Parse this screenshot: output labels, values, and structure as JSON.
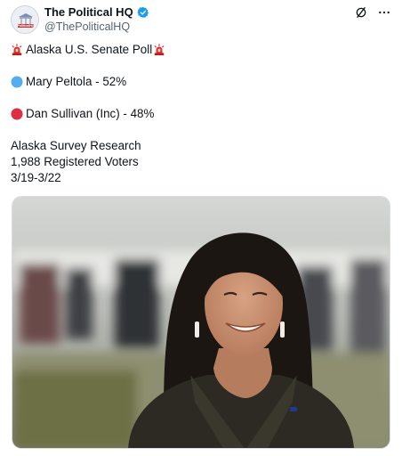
{
  "author": {
    "display_name": "The Political HQ",
    "handle": "@ThePoliticalHQ",
    "verified": true,
    "avatar_icon": "political-hq-logo-icon",
    "avatar_label": "PoliticalHQ"
  },
  "header_icons": [
    "grok-icon",
    "more-icon"
  ],
  "post": {
    "title": "Alaska U.S. Senate Poll",
    "title_icon": "siren-icon",
    "candidates": [
      {
        "name_pct": "Mary Peltola - 52%",
        "color": "#55acee",
        "icon": "blue-circle-icon"
      },
      {
        "name_pct": "Dan Sullivan (Inc) - 48%",
        "color": "#dd2e44",
        "icon": "red-circle-icon"
      }
    ],
    "source": "Alaska Survey Research",
    "sample": "1,988 Registered Voters",
    "dates": "3/19-3/22"
  },
  "colors": {
    "verified": "#1d9bf0",
    "text": "#0f1419",
    "muted": "#536471",
    "siren": "#e1332d"
  }
}
